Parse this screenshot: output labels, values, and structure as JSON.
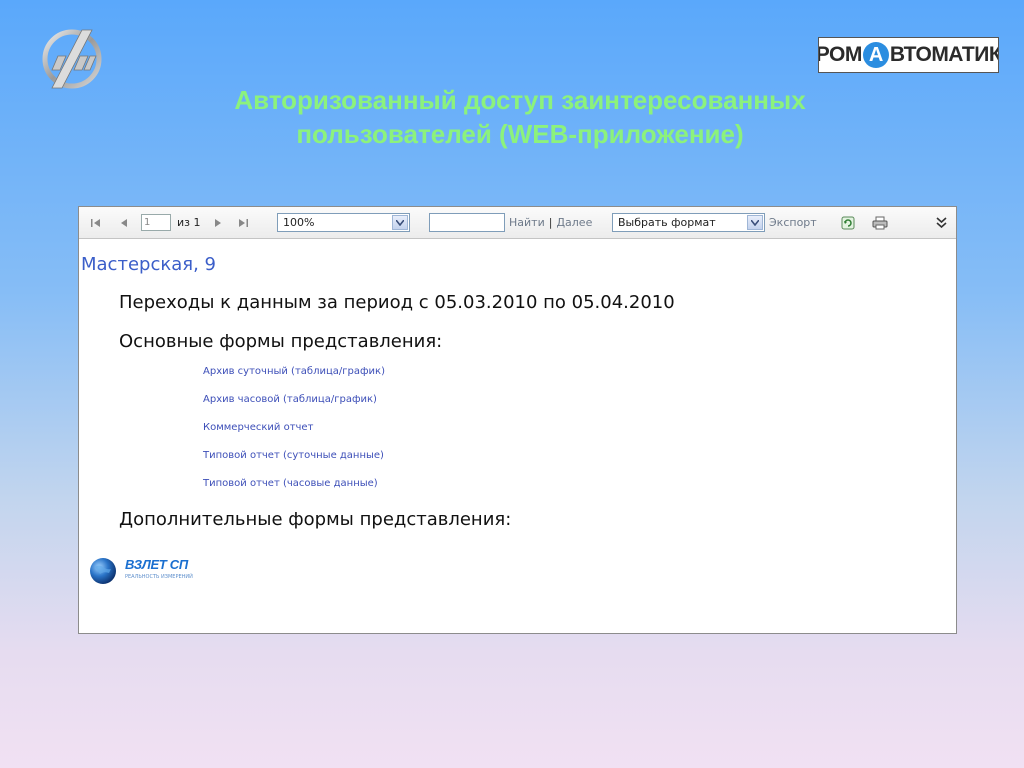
{
  "header": {
    "title_line1": "Авторизованный доступ заинтересованных",
    "title_line2": "пользователей (WEB-приложение)",
    "logo_right": {
      "part1": "ПРОМ",
      "part2": "А",
      "part3": "ВТОМАТИКА"
    }
  },
  "toolbar": {
    "page_value": "1",
    "page_of": "из 1",
    "zoom": "100%",
    "find_value": "",
    "find_label": "Найти",
    "separator": "|",
    "next_label": "Далее",
    "format_select": "Выбрать формат",
    "export_label": "Экспорт"
  },
  "report": {
    "site_name": "Мастерская, 9",
    "period": "Переходы к данным за период с 05.03.2010 по 05.04.2010",
    "main_forms_title": "Основные формы представления:",
    "links": [
      "Архив суточный (таблица/график)",
      "Архив часовой (таблица/график)",
      "Коммерческий отчет",
      "Типовой отчет (суточные данные)",
      "Типовой отчет (часовые данные)"
    ],
    "extra_forms_title": "Дополнительные формы представления:"
  },
  "footer_logo": {
    "name": "ВЗЛЕТ СП",
    "tagline": "РЕАЛЬНОСТЬ ИЗМЕРЕНИЙ"
  },
  "colors": {
    "title": "#8cf27c",
    "link": "#3d4fb8",
    "site": "#3b5ec9"
  }
}
